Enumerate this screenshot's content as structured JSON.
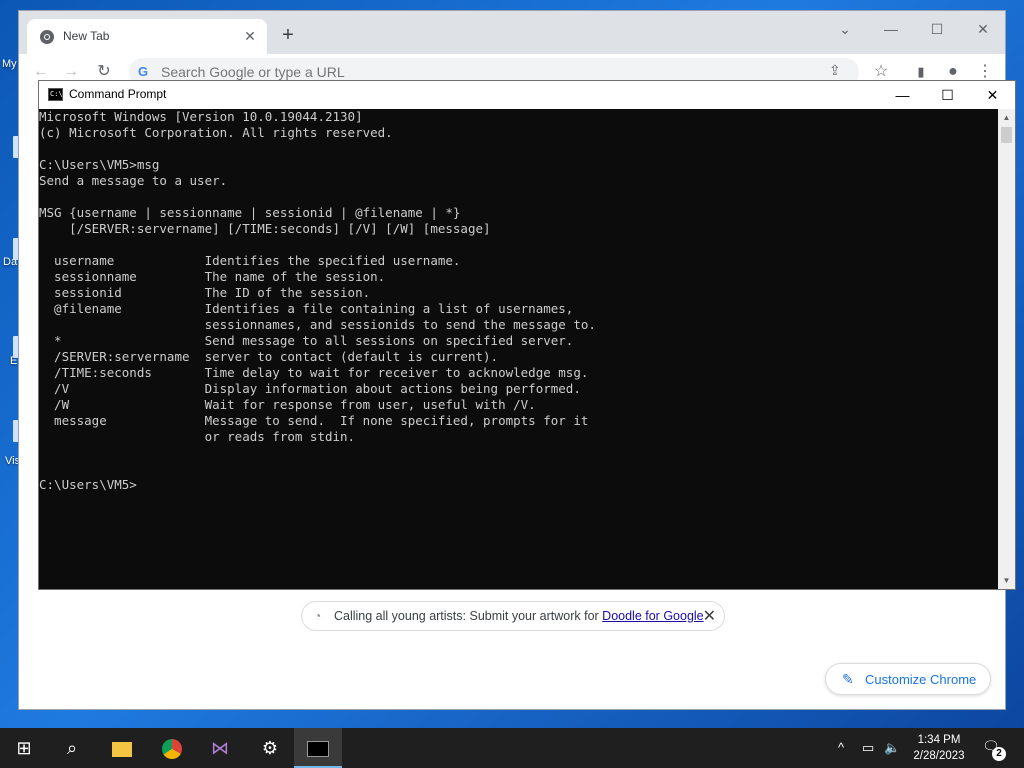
{
  "desktop": {
    "labels": [
      "My",
      "Da",
      "E",
      "Vis"
    ]
  },
  "chrome": {
    "tab_title": "New Tab",
    "tab_close": "✕",
    "new_tab": "+",
    "omnibox_placeholder": "Search Google or type a URL",
    "notice": {
      "text": "Calling all young artists: Submit your artwork for ",
      "link": "Doodle for Google",
      "close": "✕"
    },
    "customize_label": "Customize Chrome"
  },
  "cmd": {
    "title": "Command Prompt",
    "icon_text": "C:\\",
    "lines": [
      "Microsoft Windows [Version 10.0.19044.2130]",
      "(c) Microsoft Corporation. All rights reserved.",
      "",
      "C:\\Users\\VM5>msg",
      "Send a message to a user.",
      "",
      "MSG {username | sessionname | sessionid | @filename | *}",
      "    [/SERVER:servername] [/TIME:seconds] [/V] [/W] [message]",
      "",
      "  username            Identifies the specified username.",
      "  sessionname         The name of the session.",
      "  sessionid           The ID of the session.",
      "  @filename           Identifies a file containing a list of usernames,",
      "                      sessionnames, and sessionids to send the message to.",
      "  *                   Send message to all sessions on specified server.",
      "  /SERVER:servername  server to contact (default is current).",
      "  /TIME:seconds       Time delay to wait for receiver to acknowledge msg.",
      "  /V                  Display information about actions being performed.",
      "  /W                  Wait for response from user, useful with /V.",
      "  message             Message to send.  If none specified, prompts for it",
      "                      or reads from stdin.",
      "",
      "",
      "C:\\Users\\VM5>"
    ]
  },
  "taskbar": {
    "time": "1:34 PM",
    "date": "2/28/2023",
    "notification_count": "2"
  },
  "icons": {
    "start": "⊞",
    "search": "⌕",
    "back": "←",
    "forward": "→",
    "reload": "↻",
    "minimize": "—",
    "maximize": "☐",
    "close": "✕",
    "chevron": "⌄",
    "star": "☆",
    "share": "⇪",
    "menu": "⋮",
    "pencil": "✎",
    "tray_up": "^",
    "network": "▭",
    "volume": "🔈",
    "notification": "🗨"
  }
}
